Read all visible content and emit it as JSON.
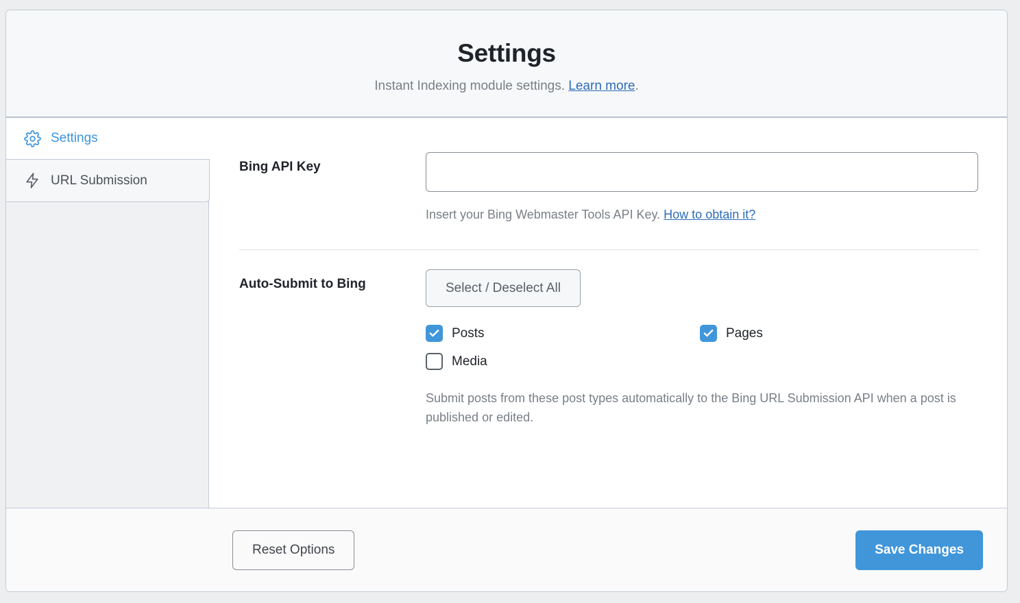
{
  "header": {
    "title": "Settings",
    "subtitle_prefix": "Instant Indexing module settings. ",
    "subtitle_link": "Learn more",
    "subtitle_suffix": "."
  },
  "sidebar": {
    "items": [
      {
        "label": "Settings",
        "icon": "gear-icon",
        "active": true
      },
      {
        "label": "URL Submission",
        "icon": "lightning-bolt-icon",
        "active": false
      }
    ]
  },
  "form": {
    "api_key": {
      "label": "Bing API Key",
      "value": "",
      "placeholder": "",
      "help_prefix": "Insert your Bing Webmaster Tools API Key. ",
      "help_link": "How to obtain it?"
    },
    "auto_submit": {
      "label": "Auto-Submit to Bing",
      "toggle_all_label": "Select / Deselect All",
      "options": [
        {
          "label": "Posts",
          "checked": true
        },
        {
          "label": "Pages",
          "checked": true
        },
        {
          "label": "Media",
          "checked": false
        }
      ],
      "description": "Submit posts from these post types automatically to the Bing URL Submission API when a post is published or edited."
    }
  },
  "footer": {
    "reset_label": "Reset Options",
    "save_label": "Save Changes"
  },
  "colors": {
    "accent": "#4196da",
    "link": "#2b6cb8",
    "text": "#20242a",
    "muted": "#787f87",
    "border": "#c3cbd4",
    "page_bg": "#eceef0"
  }
}
